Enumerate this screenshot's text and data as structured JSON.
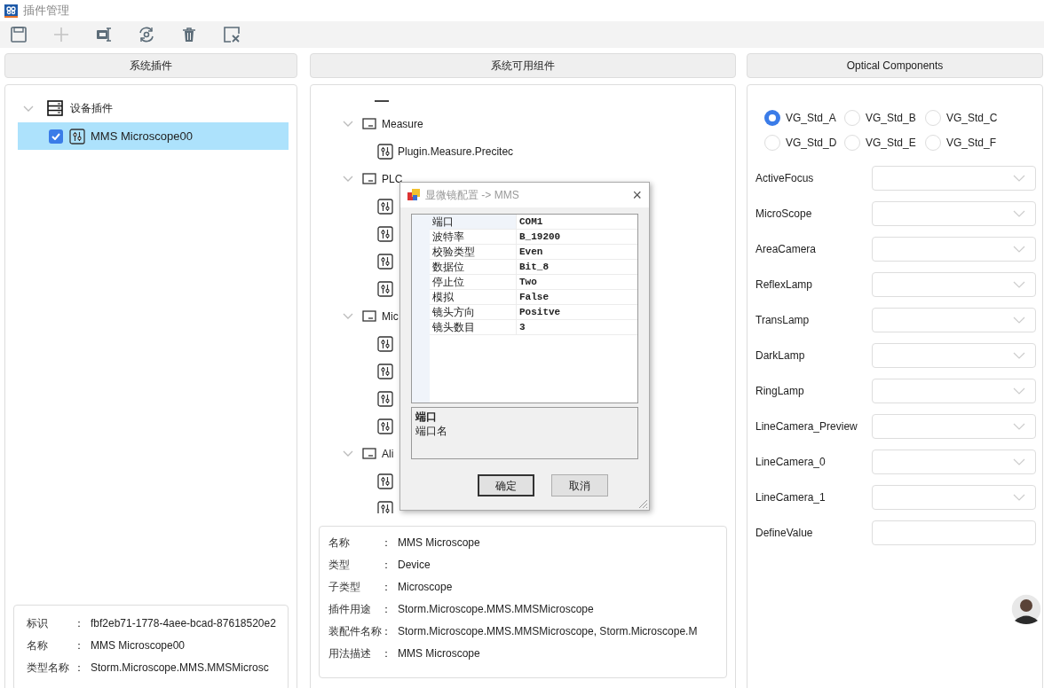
{
  "window": {
    "title": "插件管理"
  },
  "toolbar": [
    {
      "kind": "save",
      "disabled": false
    },
    {
      "kind": "add",
      "disabled": true
    },
    {
      "kind": "device",
      "disabled": false
    },
    {
      "kind": "refresh",
      "disabled": false
    },
    {
      "kind": "delete",
      "disabled": false
    },
    {
      "kind": "clear",
      "disabled": false
    }
  ],
  "left_panel": {
    "header": "系统插件",
    "tree": [
      {
        "label": "设备插件",
        "expanded": true,
        "children": [
          {
            "label": "MMS Microscope00",
            "checked": true,
            "selected": true
          }
        ]
      }
    ],
    "info": [
      {
        "label": "标识",
        "sep": "：",
        "value": "fbf2eb71-1778-4aee-bcad-87618520e2"
      },
      {
        "label": "名称",
        "sep": "：",
        "value": "MMS Microscope00"
      },
      {
        "label": "类型名称",
        "sep": "：",
        "value": "Storm.Microscope.MMS.MMSMicrosc"
      }
    ]
  },
  "middle_panel": {
    "header": "系统可用组件",
    "tree": [
      {
        "label": "Measure",
        "expanded": true,
        "children": [
          {
            "label": "Plugin.Measure.Precitec"
          }
        ]
      },
      {
        "label": "PLC",
        "expanded": true,
        "children": [
          {
            "kind": "plugin"
          },
          {
            "kind": "plugin"
          },
          {
            "kind": "plugin"
          },
          {
            "kind": "plugin"
          }
        ]
      },
      {
        "label": "Mic",
        "expanded": true,
        "children": [
          {
            "kind": "plugin"
          },
          {
            "kind": "plugin"
          },
          {
            "kind": "plugin"
          },
          {
            "kind": "plugin"
          }
        ]
      },
      {
        "label": "Ali",
        "expanded": true,
        "children": [
          {
            "kind": "plugin"
          },
          {
            "kind": "plugin"
          }
        ]
      }
    ],
    "info": [
      {
        "label": "名称",
        "sep": "：",
        "value": "MMS Microscope"
      },
      {
        "label": "类型",
        "sep": "：",
        "value": "Device"
      },
      {
        "label": "子类型",
        "sep": "：",
        "value": "Microscope"
      },
      {
        "label": "插件用途",
        "sep": "：",
        "value": "Storm.Microscope.MMS.MMSMicroscope"
      },
      {
        "label": "装配件名称",
        "sep": "：",
        "value": "Storm.Microscope.MMS.MMSMicroscope, Storm.Microscope.M"
      },
      {
        "label": "用法描述",
        "sep": "：",
        "value": "MMS Microscope"
      }
    ]
  },
  "dialog": {
    "title": "显微镜配置 -> MMS",
    "close": "×",
    "properties": [
      {
        "name": "端口",
        "value": "COM1",
        "selected": true
      },
      {
        "name": "波特率",
        "value": "B_19200",
        "selected": false
      },
      {
        "name": "校验类型",
        "value": "Even",
        "selected": false
      },
      {
        "name": "数据位",
        "value": "Bit_8",
        "selected": false
      },
      {
        "name": "停止位",
        "value": "Two",
        "selected": false
      },
      {
        "name": "模拟",
        "value": "False",
        "selected": false
      },
      {
        "name": "镜头方向",
        "value": "Positve",
        "selected": false
      },
      {
        "name": "镜头数目",
        "value": "3",
        "selected": false
      }
    ],
    "description": {
      "title": "端口",
      "text": "端口名"
    },
    "buttons": [
      {
        "label": "确定",
        "default": true
      },
      {
        "label": "取消",
        "default": false
      }
    ]
  },
  "right_panel": {
    "header": "Optical Components",
    "radios": [
      {
        "label": "VG_Std_A",
        "selected": true
      },
      {
        "label": "VG_Std_B",
        "selected": false
      },
      {
        "label": "VG_Std_C",
        "selected": false
      },
      {
        "label": "VG_Std_D",
        "selected": false
      },
      {
        "label": "VG_Std_E",
        "selected": false
      },
      {
        "label": "VG_Std_F",
        "selected": false
      }
    ],
    "fields": [
      {
        "label": "ActiveFocus",
        "kind": "select"
      },
      {
        "label": "MicroScope",
        "kind": "select"
      },
      {
        "label": "AreaCamera",
        "kind": "select"
      },
      {
        "label": "ReflexLamp",
        "kind": "select"
      },
      {
        "label": "TransLamp",
        "kind": "select"
      },
      {
        "label": "DarkLamp",
        "kind": "select"
      },
      {
        "label": "RingLamp",
        "kind": "select"
      },
      {
        "label": "LineCamera_Preview",
        "kind": "select"
      },
      {
        "label": "LineCamera_0",
        "kind": "select"
      },
      {
        "label": "LineCamera_1",
        "kind": "select"
      },
      {
        "label": "DefineValue",
        "kind": "text"
      }
    ]
  }
}
